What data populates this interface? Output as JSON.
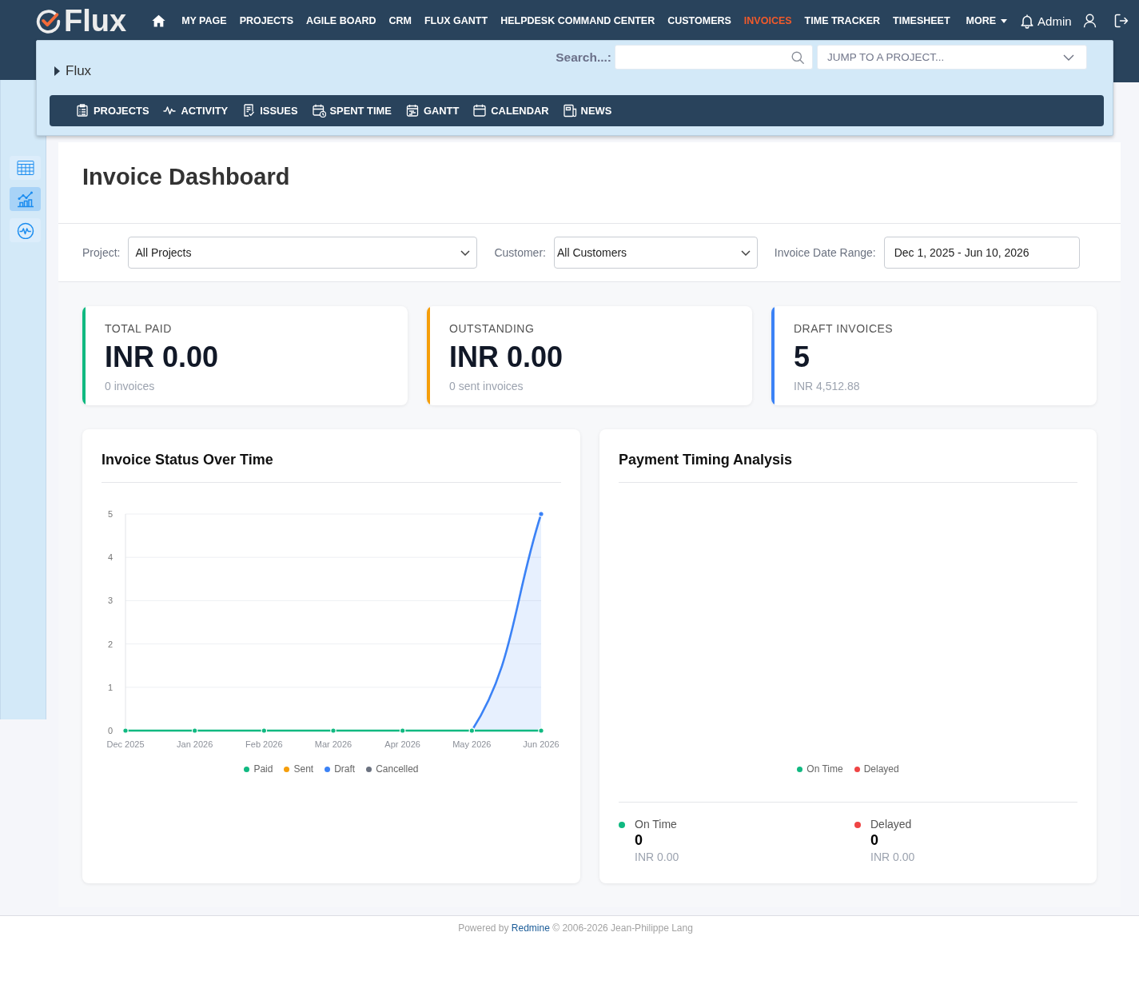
{
  "header": {
    "logo": "Flux",
    "nav": [
      {
        "label": "MY PAGE",
        "kind": "link",
        "selected": false
      },
      {
        "label": "PROJECTS",
        "kind": "link",
        "selected": false
      },
      {
        "label": "AGILE BOARD",
        "kind": "link",
        "selected": false
      },
      {
        "label": "CRM",
        "kind": "link",
        "selected": false
      },
      {
        "label": "FLUX GANTT",
        "kind": "link",
        "selected": false
      },
      {
        "label": "HELPDESK COMMAND CENTER",
        "kind": "link",
        "selected": false
      },
      {
        "label": "CUSTOMERS",
        "kind": "link",
        "selected": false
      },
      {
        "label": "INVOICES",
        "kind": "link",
        "selected": true
      },
      {
        "label": "TIME TRACKER",
        "kind": "link",
        "selected": false
      },
      {
        "label": "TIMESHEET",
        "kind": "link",
        "selected": false
      },
      {
        "label": "MORE",
        "kind": "menu",
        "selected": false
      }
    ],
    "user": "Admin"
  },
  "project_panel": {
    "breadcrumb": "Flux",
    "search_label": "Search...:",
    "jump_label": "JUMP TO A PROJECT...",
    "menu": [
      {
        "label": "PROJECTS"
      },
      {
        "label": "ACTIVITY"
      },
      {
        "label": "ISSUES"
      },
      {
        "label": "SPENT TIME"
      },
      {
        "label": "GANTT"
      },
      {
        "label": "CALENDAR"
      },
      {
        "label": "NEWS"
      }
    ]
  },
  "sidebar": {
    "items": [
      {
        "selected": false
      },
      {
        "selected": true
      },
      {
        "selected": false
      }
    ]
  },
  "dashboard": {
    "title": "Invoice Dashboard",
    "filters": [
      {
        "label": "Project:",
        "value": "All Projects",
        "kind": "select"
      },
      {
        "label": "Customer:",
        "value": "All Customers",
        "kind": "select"
      },
      {
        "label": "Invoice Date Range:",
        "value": "Dec 1, 2025 - Jun 10, 2026",
        "kind": "input"
      }
    ],
    "stats": [
      {
        "label": "TOTAL PAID",
        "value": "INR 0.00",
        "note": "0 invoices",
        "color": "#10b981"
      },
      {
        "label": "OUTSTANDING",
        "value": "INR 0.00",
        "note": "0 sent invoices",
        "color": "#f59e0b"
      },
      {
        "label": "DRAFT INVOICES",
        "value": "5",
        "note": "INR 4,512.88",
        "color": "#3b82f6"
      }
    ],
    "status_chart": {
      "title": "Invoice Status Over Time",
      "chart_data": {
        "type": "area",
        "categories": [
          "Dec 2025",
          "Jan 2026",
          "Feb 2026",
          "Mar 2026",
          "Apr 2026",
          "May 2026",
          "Jun 2026"
        ],
        "series": [
          {
            "name": "Paid",
            "color": "#10b981",
            "values": [
              0,
              0,
              0,
              0,
              0,
              0,
              0
            ]
          },
          {
            "name": "Sent",
            "color": "#f59e0b",
            "values": [
              null,
              null,
              null,
              null,
              null,
              null,
              null
            ]
          },
          {
            "name": "Draft",
            "color": "#3b82f6",
            "values": [
              null,
              null,
              null,
              null,
              null,
              0,
              5
            ]
          },
          {
            "name": "Cancelled",
            "color": "#6b7280",
            "values": [
              null,
              null,
              null,
              null,
              null,
              null,
              null
            ]
          }
        ],
        "ylim": [
          0,
          5
        ],
        "yticks": [
          0,
          1,
          2,
          3,
          4,
          5
        ],
        "grid": true,
        "legend": "bottom"
      }
    },
    "payment_timing": {
      "title": "Payment Timing Analysis",
      "legend": [
        {
          "label": "On Time",
          "color": "#10b981"
        },
        {
          "label": "Delayed",
          "color": "#ef4444"
        }
      ],
      "summary": [
        {
          "label": "On Time",
          "count": "0",
          "amount": "INR 0.00",
          "color": "#10b981"
        },
        {
          "label": "Delayed",
          "count": "0",
          "amount": "INR 0.00",
          "color": "#ef4444"
        }
      ]
    }
  },
  "footer": {
    "prefix": "Powered by",
    "link": "Redmine",
    "suffix": "© 2006-2026 Jean-Philippe Lang"
  }
}
